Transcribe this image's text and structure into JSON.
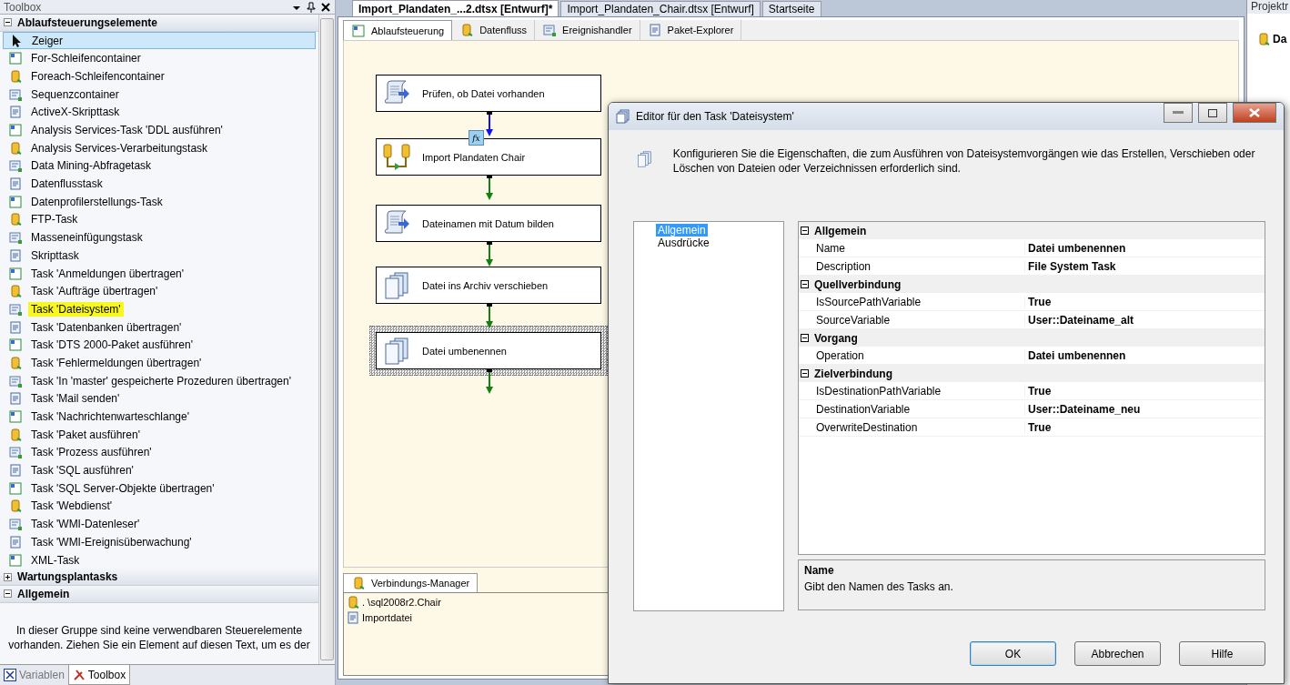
{
  "toolbox": {
    "title": "Toolbox",
    "groups": [
      {
        "label": "Ablaufsteuerungselemente",
        "expanded": true,
        "items": [
          {
            "label": "Zeiger",
            "selected": true,
            "highlighted": false
          },
          {
            "label": "For-Schleifencontainer",
            "selected": false,
            "highlighted": false
          },
          {
            "label": "Foreach-Schleifencontainer",
            "selected": false,
            "highlighted": false
          },
          {
            "label": "Sequenzcontainer",
            "selected": false,
            "highlighted": false
          },
          {
            "label": "ActiveX-Skripttask",
            "selected": false,
            "highlighted": false
          },
          {
            "label": "Analysis Services-Task 'DDL ausführen'",
            "selected": false,
            "highlighted": false
          },
          {
            "label": "Analysis Services-Verarbeitungstask",
            "selected": false,
            "highlighted": false
          },
          {
            "label": "Data Mining-Abfragetask",
            "selected": false,
            "highlighted": false
          },
          {
            "label": "Datenflusstask",
            "selected": false,
            "highlighted": false
          },
          {
            "label": "Datenprofilerstellungs-Task",
            "selected": false,
            "highlighted": false
          },
          {
            "label": "FTP-Task",
            "selected": false,
            "highlighted": false
          },
          {
            "label": "Masseneinfügungstask",
            "selected": false,
            "highlighted": false
          },
          {
            "label": "Skripttask",
            "selected": false,
            "highlighted": false
          },
          {
            "label": "Task 'Anmeldungen übertragen'",
            "selected": false,
            "highlighted": false
          },
          {
            "label": "Task 'Aufträge übertragen'",
            "selected": false,
            "highlighted": false
          },
          {
            "label": "Task 'Dateisystem'",
            "selected": false,
            "highlighted": true
          },
          {
            "label": "Task 'Datenbanken übertragen'",
            "selected": false,
            "highlighted": false
          },
          {
            "label": "Task 'DTS 2000-Paket ausführen'",
            "selected": false,
            "highlighted": false
          },
          {
            "label": "Task 'Fehlermeldungen übertragen'",
            "selected": false,
            "highlighted": false
          },
          {
            "label": "Task 'In 'master' gespeicherte Prozeduren übertragen'",
            "selected": false,
            "highlighted": false
          },
          {
            "label": "Task 'Mail senden'",
            "selected": false,
            "highlighted": false
          },
          {
            "label": "Task 'Nachrichtenwarteschlange'",
            "selected": false,
            "highlighted": false
          },
          {
            "label": "Task 'Paket ausführen'",
            "selected": false,
            "highlighted": false
          },
          {
            "label": "Task 'Prozess ausführen'",
            "selected": false,
            "highlighted": false
          },
          {
            "label": "Task 'SQL ausführen'",
            "selected": false,
            "highlighted": false
          },
          {
            "label": "Task 'SQL Server-Objekte übertragen'",
            "selected": false,
            "highlighted": false
          },
          {
            "label": "Task 'Webdienst'",
            "selected": false,
            "highlighted": false
          },
          {
            "label": "Task 'WMI-Datenleser'",
            "selected": false,
            "highlighted": false
          },
          {
            "label": "Task 'WMI-Ereignisüberwachung'",
            "selected": false,
            "highlighted": false
          },
          {
            "label": "XML-Task",
            "selected": false,
            "highlighted": false
          }
        ]
      },
      {
        "label": "Wartungsplantasks",
        "expanded": false
      },
      {
        "label": "Allgemein",
        "expanded": true,
        "empty_text": "In dieser Gruppe sind keine verwendbaren Steuerelemente vorhanden. Ziehen Sie ein Element auf diesen Text, um es der"
      }
    ],
    "bottom_tabs": [
      {
        "label": "Variablen",
        "selected": false
      },
      {
        "label": "Toolbox",
        "selected": true
      }
    ]
  },
  "documents": {
    "tabs": [
      {
        "label": "Import_Plandaten_...2.dtsx [Entwurf]*",
        "selected": true
      },
      {
        "label": "Import_Plandaten_Chair.dtsx [Entwurf]",
        "selected": false
      },
      {
        "label": "Startseite",
        "selected": false
      }
    ],
    "designer_tabs": [
      {
        "label": "Ablaufsteuerung",
        "selected": true
      },
      {
        "label": "Datenfluss",
        "selected": false
      },
      {
        "label": "Ereignishandler",
        "selected": false
      },
      {
        "label": "Paket-Explorer",
        "selected": false
      }
    ],
    "tasks": [
      {
        "label": "Prüfen, ob Datei vorhanden",
        "kind": "script",
        "selected": false
      },
      {
        "label": "Import Plandaten Chair",
        "kind": "dataflow",
        "selected": false
      },
      {
        "label": "Dateinamen mit Datum bilden",
        "kind": "script",
        "selected": false
      },
      {
        "label": "Datei ins Archiv verschieben",
        "kind": "filesystem",
        "selected": false
      },
      {
        "label": "Datei umbenennen",
        "kind": "filesystem",
        "selected": true
      }
    ],
    "connectors": [
      {
        "kind": "expression",
        "badge": "fx"
      },
      {
        "kind": "success"
      },
      {
        "kind": "success"
      },
      {
        "kind": "success"
      },
      {
        "kind": "success"
      }
    ],
    "connection_manager": {
      "title": "Verbindungs-Manager",
      "items": [
        {
          "label": ". \\sql2008r2.Chair",
          "kind": "database"
        },
        {
          "label": "Importdatei",
          "kind": "file"
        }
      ]
    }
  },
  "project_panel": {
    "title": "Projektr",
    "root": "Da"
  },
  "dialog": {
    "title": "Editor für den Task 'Dateisystem'",
    "intro": "Konfigurieren Sie die Eigenschaften, die zum Ausführen von Dateisystemvorgängen wie das Erstellen, Verschieben oder Löschen von Dateien oder Verzeichnissen erforderlich sind.",
    "pages": [
      {
        "label": "Allgemein",
        "selected": true
      },
      {
        "label": "Ausdrücke",
        "selected": false
      }
    ],
    "categories": [
      {
        "label": "Allgemein",
        "expanded": true,
        "properties": [
          {
            "name": "Name",
            "value": "Datei umbenennen"
          },
          {
            "name": "Description",
            "value": "File System Task"
          }
        ]
      },
      {
        "label": "Quellverbindung",
        "expanded": true,
        "properties": [
          {
            "name": "IsSourcePathVariable",
            "value": "True"
          },
          {
            "name": "SourceVariable",
            "value": "User::Dateiname_alt"
          }
        ]
      },
      {
        "label": "Vorgang",
        "expanded": true,
        "properties": [
          {
            "name": "Operation",
            "value": "Datei umbenennen"
          }
        ]
      },
      {
        "label": "Zielverbindung",
        "expanded": true,
        "properties": [
          {
            "name": "IsDestinationPathVariable",
            "value": "True"
          },
          {
            "name": "DestinationVariable",
            "value": "User::Dateiname_neu"
          },
          {
            "name": "OverwriteDestination",
            "value": "True"
          }
        ]
      }
    ],
    "help_title": "Name",
    "help_text": "Gibt den Namen des Tasks an.",
    "buttons": [
      {
        "label": "OK",
        "default": true
      },
      {
        "label": "Abbrechen",
        "default": false
      },
      {
        "label": "Hilfe",
        "default": false
      }
    ]
  }
}
